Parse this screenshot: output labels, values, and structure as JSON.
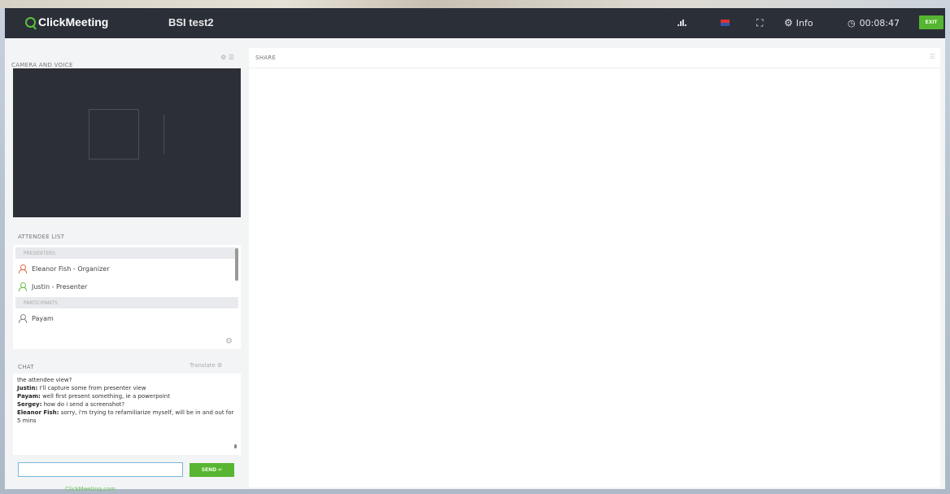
{
  "app": {
    "logo_text": "ClickMeeting",
    "meeting_title": "BSI test2",
    "brand_green": "#55b531",
    "bar_color": "#2b2f38"
  },
  "toolbar": {
    "signal_icon": "signal-strength-icon",
    "flag_icon": "flag-icon",
    "expand_icon": "fullscreen-icon",
    "info_label": "Info",
    "timer": "00:08:47",
    "exit_label": "EXIT"
  },
  "camera": {
    "title": "CAMERA AND VOICE",
    "icon": "camera-off-icon"
  },
  "attendees": {
    "title": "ATTENDEE LIST",
    "groups": [
      {
        "label": "PRESENTERS",
        "members": [
          {
            "name": "Eleanor Fish - Organizer",
            "role": "organizer"
          },
          {
            "name": "Justin - Presenter",
            "role": "presenter"
          }
        ]
      },
      {
        "label": "PARTICIPANTS",
        "members": [
          {
            "name": "Payam",
            "role": "attendee"
          }
        ]
      }
    ]
  },
  "chat": {
    "title": "CHAT",
    "translate_label": "Translate",
    "messages": [
      {
        "author": "",
        "text": "the attendee view?"
      },
      {
        "author": "Justin:",
        "text": " I'll capture some from presenter view"
      },
      {
        "author": "Payam:",
        "text": " well first present something, ie a powerpoint"
      },
      {
        "author": "Sergey:",
        "text": " how do i send a screenshot?"
      },
      {
        "author": "Eleanor Fish:",
        "text": " sorry, i'm trying to refamiliarize myself, will be in and out for 5 mins"
      }
    ],
    "input_value": "",
    "send_label": "SEND"
  },
  "share": {
    "title": "SHARE"
  },
  "footer": {
    "link": "ClickMeeting.com"
  }
}
